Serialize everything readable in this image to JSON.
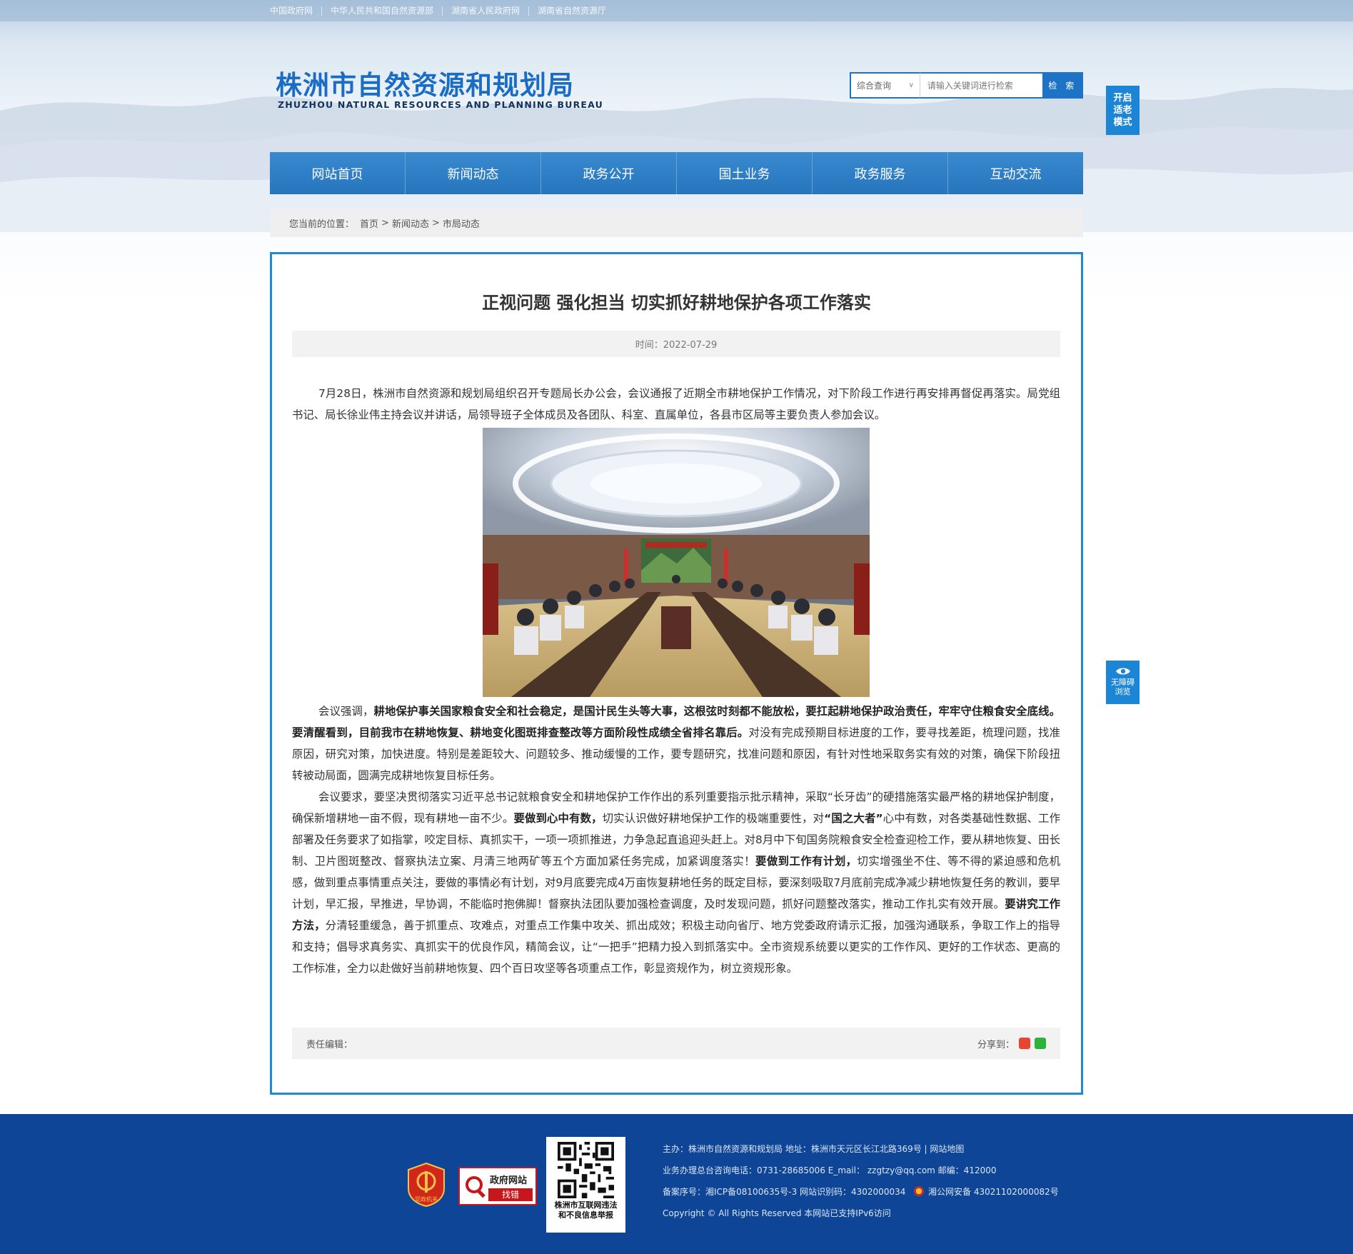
{
  "top_links": [
    "中国政府网",
    "中华人民共和国自然资源部",
    "湖南省人民政府网",
    "湖南省自然资源厅"
  ],
  "logo": {
    "cn": "株洲市自然资源和规划局",
    "en": "ZHUZHOU NATURAL RESOURCES AND PLANNING BUREAU"
  },
  "search": {
    "scope": "综合查询",
    "placeholder": "请输入关键词进行检索",
    "button": "检 索"
  },
  "side_buttons": {
    "elder_mode": "开启适老模式",
    "accessible": "无障碍浏览"
  },
  "nav": [
    "网站首页",
    "新闻动态",
    "政务公开",
    "国土业务",
    "政务服务",
    "互动交流"
  ],
  "breadcrumb": {
    "label": "您当前的位置：",
    "items": [
      "首页",
      "新闻动态",
      "市局动态"
    ],
    "sep": ">"
  },
  "article": {
    "title": "正视问题 强化担当 切实抓好耕地保护各项工作落实",
    "time": "时间：2022-07-29",
    "p1": "7月28日，株洲市自然资源和规划局组织召开专题局长办公会，会议通报了近期全市耕地保护工作情况，对下阶段工作进行再安排再督促再落实。局党组书记、局长徐业伟主持会议并讲话，局领导班子全体成员及各团队、科室、直属单位，各县市区局等主要负责人参加会议。",
    "p2": [
      {
        "t": "会议强调，",
        "b": false
      },
      {
        "t": "耕地保护事关国家粮食安全和社会稳定，是国计民生头等大事，这根弦时刻都不能放松，要扛起耕地保护政治责任，牢牢守住粮食安全底线。要清醒看到，目前我市在耕地恢复、耕地变化图斑排查整改等方面阶段性成绩全省排名靠后。",
        "b": true
      },
      {
        "t": "对没有完成预期目标进度的工作，要寻找差距，梳理问题，找准原因，研究对策，加快进度。特别是差距较大、问题较多、推动缓慢的工作，要专题研究，找准问题和原因，有针对性地采取务实有效的对策，确保下阶段扭转被动局面，圆满完成耕地恢复目标任务。",
        "b": false
      }
    ],
    "p3": [
      {
        "t": "会议要求，要坚决贯彻落实习近平总书记就粮食安全和耕地保护工作作出的系列重要指示批示精神，采取“长牙齿”的硬措施落实最严格的耕地保护制度，确保新增耕地一亩不假，现有耕地一亩不少。",
        "b": false
      },
      {
        "t": "要做到心中有数，",
        "b": true
      },
      {
        "t": "切实认识做好耕地保护工作的极端重要性，对",
        "b": false
      },
      {
        "t": "“国之大者”",
        "b": true
      },
      {
        "t": "心中有数，对各类基础性数据、工作部署及任务要求了如指掌，咬定目标、真抓实干，一项一项抓推进，力争急起直追迎头赶上。对8月中下旬国务院粮食安全检查迎检工作，要从耕地恢复、田长制、卫片图斑整改、督察执法立案、月清三地两矿等五个方面加紧任务完成，加紧调度落实！",
        "b": false
      },
      {
        "t": "要做到工作有计划，",
        "b": true
      },
      {
        "t": "切实增强坐不住、等不得的紧迫感和危机感，做到重点事情重点关注，要做的事情必有计划，对9月底要完成4万亩恢复耕地任务的既定目标，要深刻吸取7月底前完成净减少耕地恢复任务的教训，要早计划，早汇报，早推进，早协调，不能临时抱佛脚！督察执法团队要加强检查调度，及时发现问题，抓好问题整改落实，推动工作扎实有效开展。",
        "b": false
      },
      {
        "t": "要讲究工作方法，",
        "b": true
      },
      {
        "t": "分清轻重缓急，善于抓重点、攻难点，对重点工作集中攻关、抓出成效；积极主动向省厅、地方党委政府请示汇报，加强沟通联系，争取工作上的指导和支持；倡导求真务实、真抓实干的优良作风，精简会议，让“一把手”把精力投入到抓落实中。全市资规系统要以更实的工作作风、更好的工作状态、更高的工作标准，全力以赴做好当前耕地恢复、四个百日攻坚等各项重点工作，彰显资规作为，树立资规形象。",
        "b": false
      }
    ],
    "editor": "责任编辑：",
    "share": "分享到："
  },
  "footer": {
    "line1": "主办：株洲市自然资源和规划局  地址：株洲市天元区长江北路369号  |  网站地图",
    "line2": "业务办理总台咨询电话：0731-28685006    E_mail：  zzgtzy@qq.com    邮编：412000",
    "line3a": "备案序号：湘ICP备08100635号-3 网站识别码：4302000034",
    "line3b": "湘公网安备 43021102000082号",
    "line4": "Copyright © All Rights Reserved 本网站已支持IPv6访问",
    "badge_party": "党政机关",
    "badge_fix_title": "政府网站",
    "badge_fix_sub": "找错",
    "qr_caption_1": "株洲市互联网违法",
    "qr_caption_2": "和不良信息举报"
  }
}
